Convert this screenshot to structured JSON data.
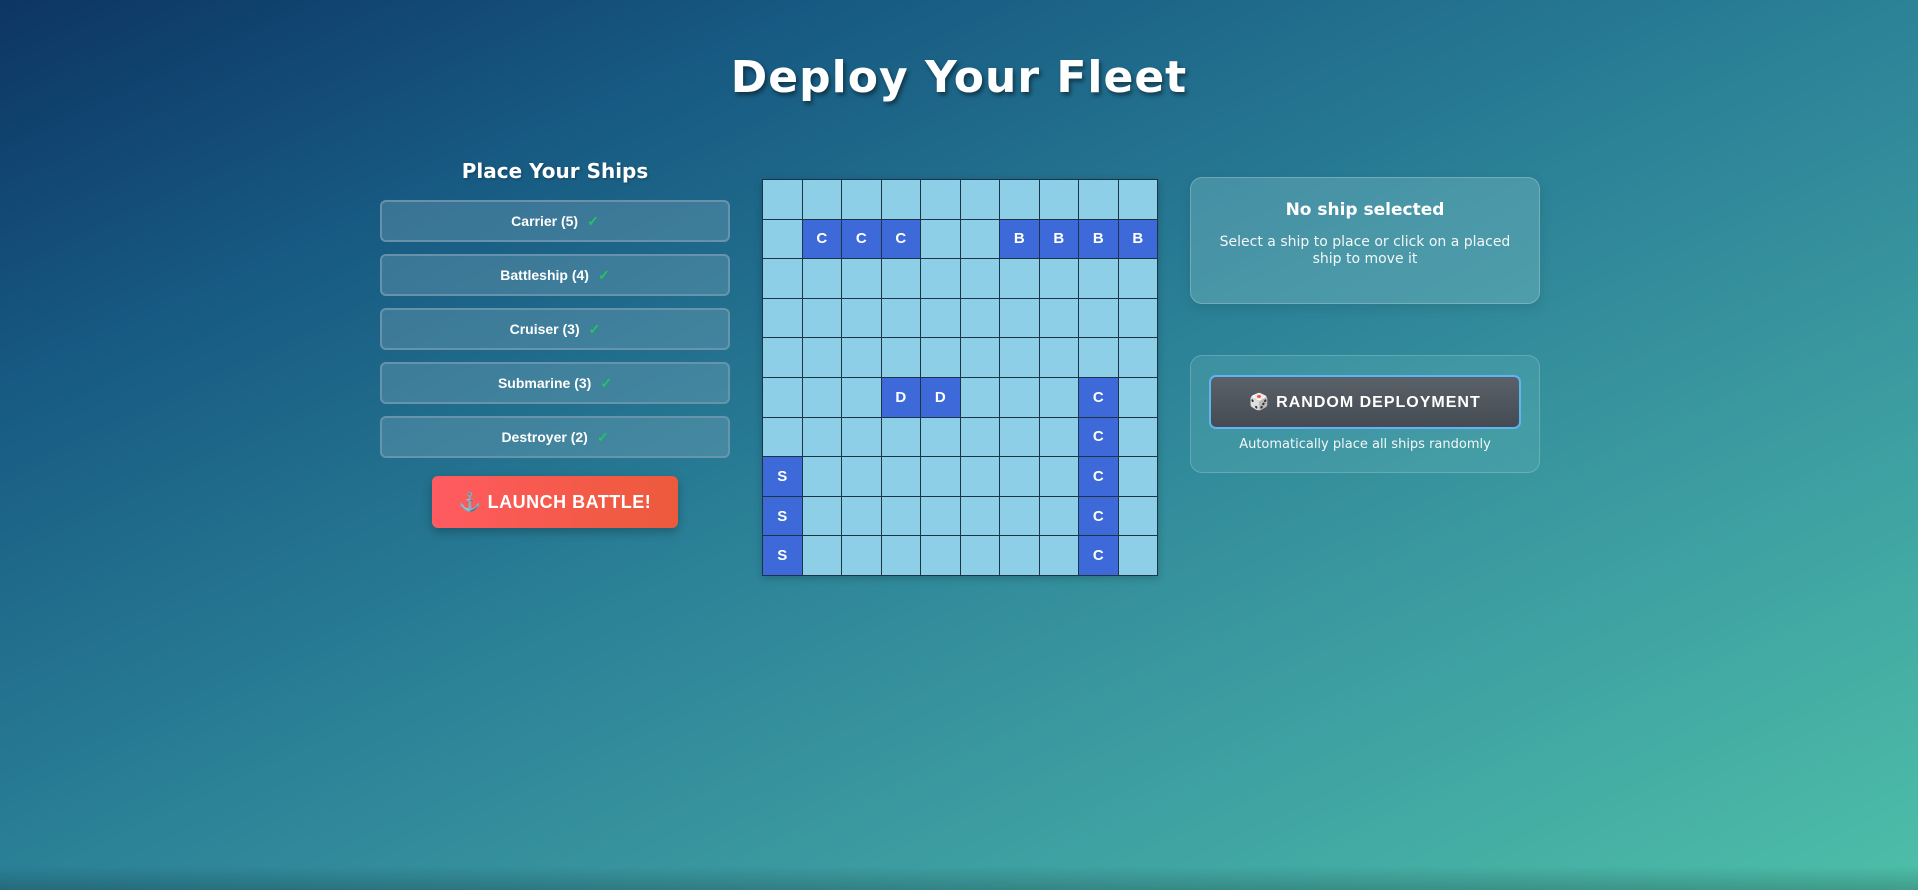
{
  "header": {
    "title": "Deploy Your Fleet"
  },
  "ship_panel": {
    "heading": "Place Your Ships",
    "ships": [
      {
        "label": "Carrier (5)",
        "status_icon": "✓"
      },
      {
        "label": "Battleship (4)",
        "status_icon": "✓"
      },
      {
        "label": "Cruiser (3)",
        "status_icon": "✓"
      },
      {
        "label": "Submarine (3)",
        "status_icon": "✓"
      },
      {
        "label": "Destroyer (2)",
        "status_icon": "✓"
      }
    ],
    "launch_icon": "⚓",
    "launch_label": "LAUNCH BATTLE!"
  },
  "board": {
    "rows": [
      [
        "",
        "",
        "",
        "",
        "",
        "",
        "",
        "",
        "",
        ""
      ],
      [
        "",
        "C",
        "C",
        "C",
        "",
        "",
        "B",
        "B",
        "B",
        "B"
      ],
      [
        "",
        "",
        "",
        "",
        "",
        "",
        "",
        "",
        "",
        ""
      ],
      [
        "",
        "",
        "",
        "",
        "",
        "",
        "",
        "",
        "",
        ""
      ],
      [
        "",
        "",
        "",
        "",
        "",
        "",
        "",
        "",
        "",
        ""
      ],
      [
        "",
        "",
        "",
        "D",
        "D",
        "",
        "",
        "",
        "C",
        ""
      ],
      [
        "",
        "",
        "",
        "",
        "",
        "",
        "",
        "",
        "C",
        ""
      ],
      [
        "S",
        "",
        "",
        "",
        "",
        "",
        "",
        "",
        "C",
        ""
      ],
      [
        "S",
        "",
        "",
        "",
        "",
        "",
        "",
        "",
        "C",
        ""
      ],
      [
        "S",
        "",
        "",
        "",
        "",
        "",
        "",
        "",
        "C",
        ""
      ]
    ],
    "colors": {
      "water": "#8ecfe8",
      "ship": "#3d6ad8",
      "grid": "#1d3448"
    }
  },
  "info_panel": {
    "title": "No ship selected",
    "description": "Select a ship to place or click on a placed ship to move it"
  },
  "random_panel": {
    "icon": "🎲",
    "button_label": "RANDOM DEPLOYMENT",
    "description": "Automatically place all ships randomly"
  }
}
